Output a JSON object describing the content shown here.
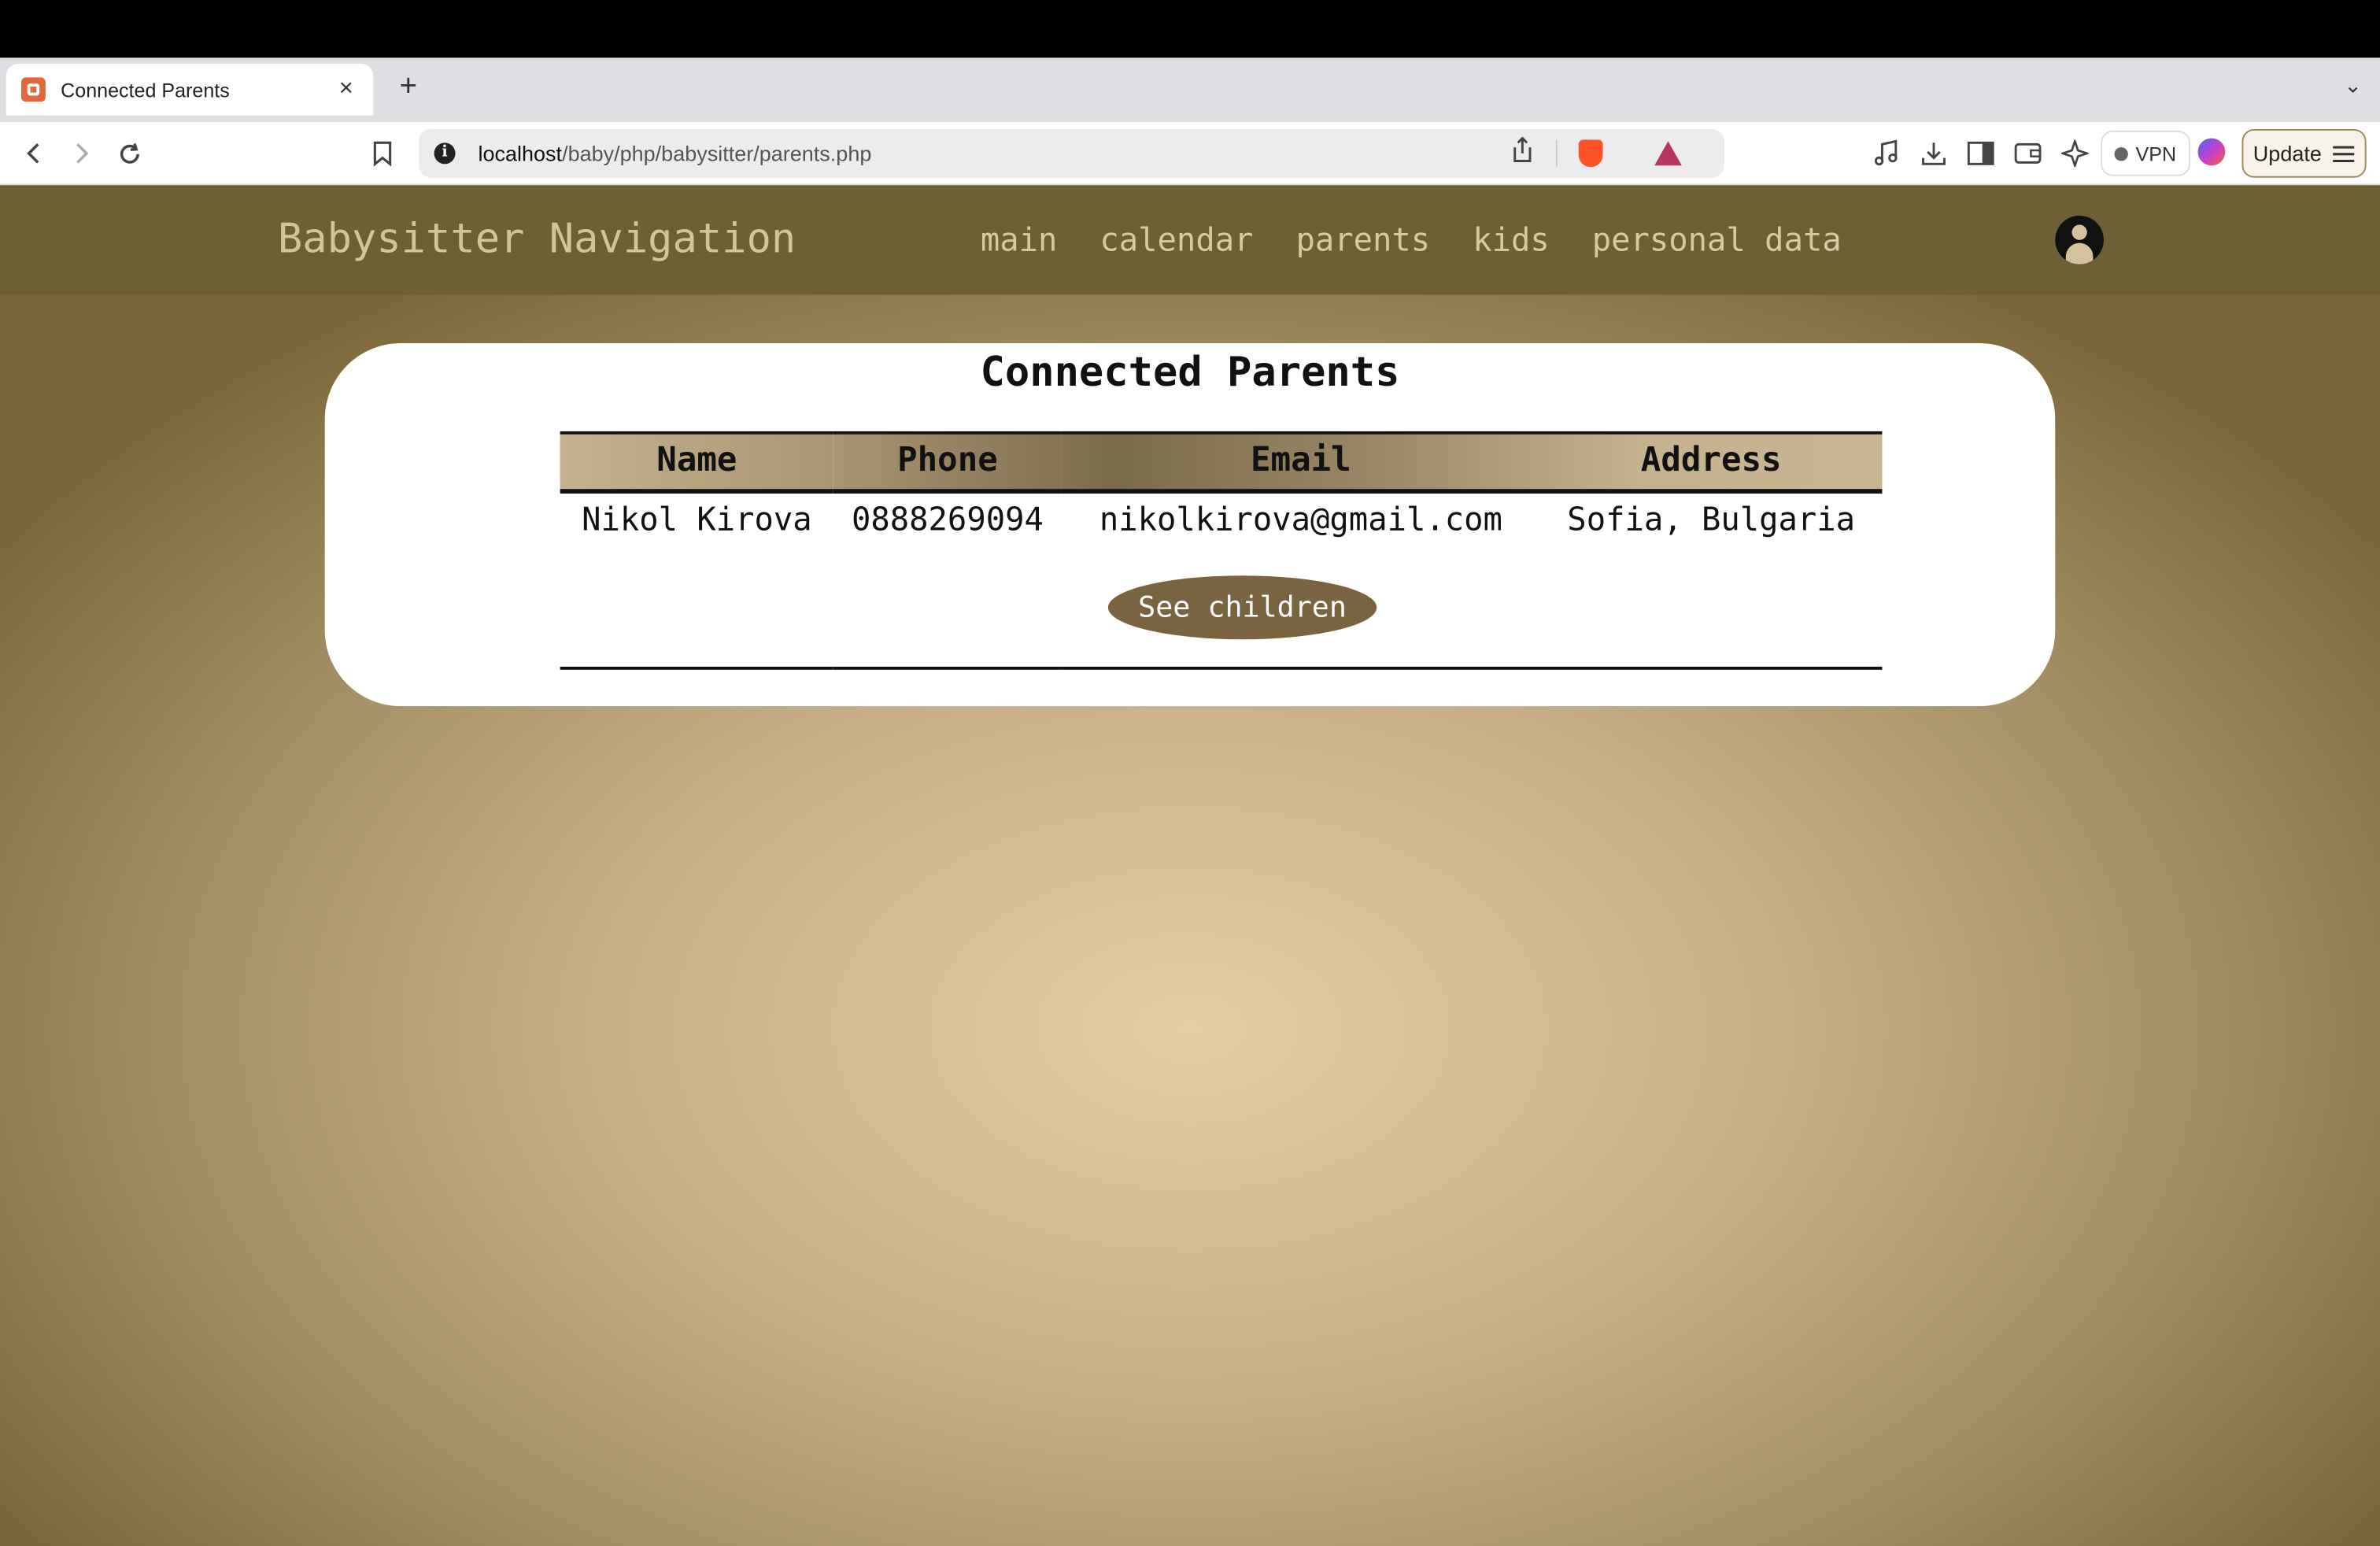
{
  "browser": {
    "tab_title": "Connected Parents",
    "tab_close": "×",
    "new_tab": "+",
    "tab_list": "⌄",
    "url_host": "localhost",
    "url_path": "/baby/php/babysitter/parents.php",
    "vpn_label": "VPN",
    "update_label": "Update",
    "icons": [
      "back-icon",
      "forward-icon",
      "reload-icon",
      "bookmark-icon",
      "site-info-icon",
      "share-icon",
      "brave-shields-icon",
      "brave-rewards-icon",
      "media-icon",
      "download-icon",
      "sidebar-icon",
      "wallet-icon",
      "leo-ai-icon",
      "vpn-icon",
      "menu-icon"
    ]
  },
  "nav": {
    "brand": "Babysitter Navigation",
    "links": [
      "main",
      "calendar",
      "parents",
      "kids",
      "personal data"
    ]
  },
  "page": {
    "title": "Connected Parents",
    "table": {
      "headers": [
        "Name",
        "Phone",
        "Email",
        "Address"
      ],
      "rows": [
        [
          "Nikol Kirova",
          "0888269094",
          "nikolkirova@gmail.com",
          "Sofia, Bulgaria"
        ]
      ]
    },
    "see_children_label": "See children"
  },
  "colors": {
    "nav_bg": "#6e5f35",
    "nav_text": "#d9c8a4",
    "button_bg": "#7a6440",
    "brave_orange": "#fb542b"
  }
}
